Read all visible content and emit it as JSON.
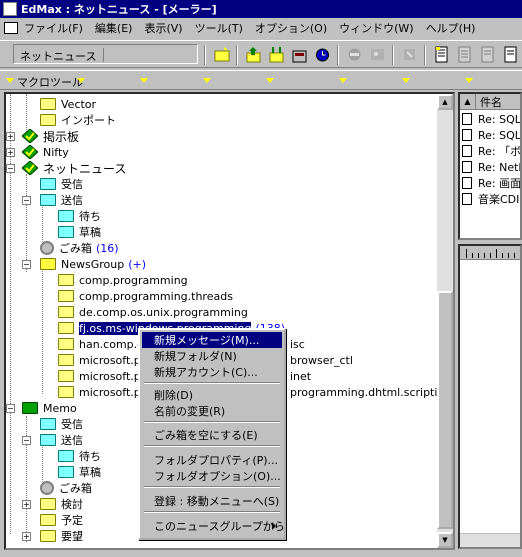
{
  "window": {
    "title": "EdMax : ネットニュース - [メーラー]"
  },
  "menu": [
    "ファイル(F)",
    "編集(E)",
    "表示(V)",
    "ツール(T)",
    "オプション(O)",
    "ウィンドウ(W)",
    "ヘルプ(H)"
  ],
  "toolbar": {
    "folder_combo": "ネットニュース"
  },
  "macrobar": {
    "label": "マクロツール"
  },
  "tree": {
    "vector": "Vector",
    "import": "インポート",
    "keijiban": "掲示板",
    "nifty": "Nifty",
    "netnews": "ネットニュース",
    "inbox": "受信",
    "sent": "送信",
    "waiting": "待ち",
    "draft": "草稿",
    "trash": "ごみ箱",
    "trash_count": "(16)",
    "newsgroup": "NewsGroup",
    "newsgroup_plus": "(+)",
    "groups": [
      "comp.programming",
      "comp.programming.threads",
      "de.comp.os.unix.programming",
      "fj.os.ms-windows.programming",
      "han.comp.os",
      "microsoft.pu",
      "microsoft.pu",
      "microsoft.pu"
    ],
    "selected_count": "(138)",
    "group_tails": [
      "isc",
      "browser_ctl",
      "inet",
      "programming.dhtml.scripting"
    ],
    "memo": "Memo",
    "memo_inbox": "受信",
    "memo_sent": "送信",
    "memo_waiting": "待ち",
    "memo_draft": "草稿",
    "memo_trash": "ごみ箱",
    "kento": "検討",
    "yotei": "予定",
    "youbou": "要望"
  },
  "message_list": {
    "header": "件名",
    "rows": [
      "Re: SQLS",
      "Re: SQLS",
      "Re: 「ボイ",
      "Re: NetR",
      "Re: 画面",
      "音楽CDI"
    ]
  },
  "context_menu": {
    "items": [
      "新規メッセージ(M)...",
      "新規フォルダ(N)",
      "新規アカウント(C)...",
      "削除(D)",
      "名前の変更(R)",
      "ごみ箱を空にする(E)",
      "フォルダプロパティ(P)...",
      "フォルダオプション(O)...",
      "登録 : 移動メニューへ(S)",
      "このニュースグループから"
    ]
  }
}
